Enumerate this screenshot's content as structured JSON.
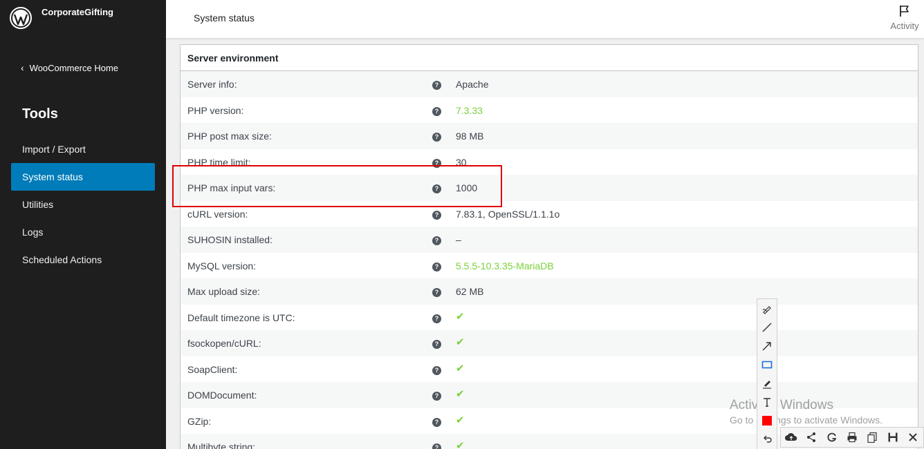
{
  "sidebar": {
    "site_name": "CorporateGifting",
    "back_label": "WooCommerce Home",
    "section_title": "Tools",
    "items": [
      {
        "label": "Import / Export"
      },
      {
        "label": "System status"
      },
      {
        "label": "Utilities"
      },
      {
        "label": "Logs"
      },
      {
        "label": "Scheduled Actions"
      }
    ]
  },
  "header": {
    "title": "System status",
    "activity_label": "Activity"
  },
  "panel": {
    "title": "Server environment",
    "help_glyph": "?",
    "rows": [
      {
        "label": "Server info:",
        "value": "Apache"
      },
      {
        "label": "PHP version:",
        "value": "7.3.33"
      },
      {
        "label": "PHP post max size:",
        "value": "98 MB"
      },
      {
        "label": "PHP time limit:",
        "value": "30"
      },
      {
        "label": "PHP max input vars:",
        "value": "1000"
      },
      {
        "label": "cURL version:",
        "value": "7.83.1, OpenSSL/1.1.1o"
      },
      {
        "label": "SUHOSIN installed:",
        "value": "–"
      },
      {
        "label": "MySQL version:",
        "value": "5.5.5-10.3.35-MariaDB"
      },
      {
        "label": "Max upload size:",
        "value": "62 MB"
      },
      {
        "label": "Default timezone is UTC:",
        "value": "✔"
      },
      {
        "label": "fsockopen/cURL:",
        "value": "✔"
      },
      {
        "label": "SoapClient:",
        "value": "✔"
      },
      {
        "label": "DOMDocument:",
        "value": "✔"
      },
      {
        "label": "GZip:",
        "value": "✔"
      },
      {
        "label": "Multibyte string:",
        "value": "✔"
      }
    ]
  },
  "watermark": {
    "line1": "Activate Windows",
    "line2": "Go to Settings to activate Windows."
  },
  "colors": {
    "accent": "#007cba",
    "ok_green": "#7ad03a",
    "highlight_red": "#e00000"
  }
}
